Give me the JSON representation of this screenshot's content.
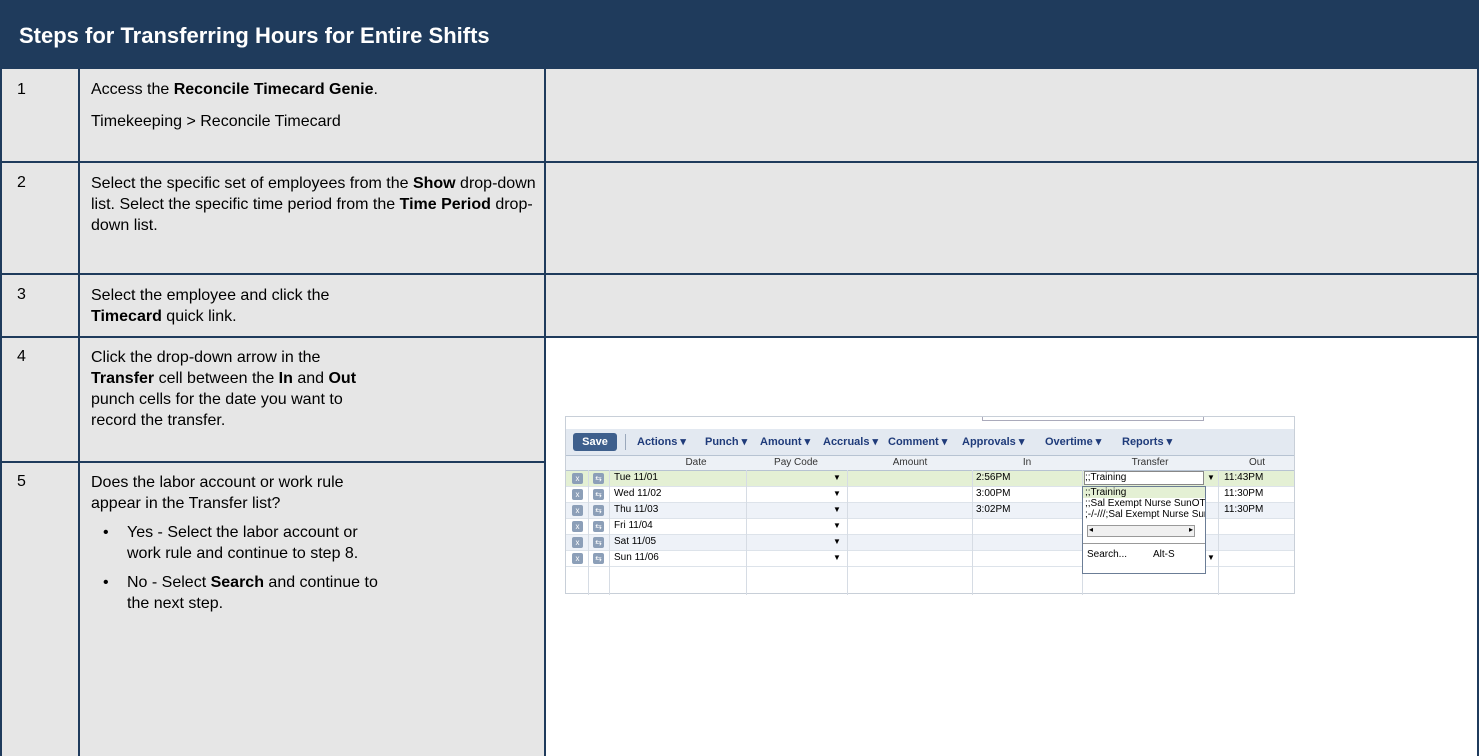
{
  "title": "Steps for Transferring Hours for Entire Shifts",
  "steps": [
    {
      "num": "1",
      "pre": "Access the ",
      "bold": "Reconcile Timecard Genie",
      "post": ".",
      "path": "Timekeeping > Reconcile Timecard"
    },
    {
      "num": "2",
      "text_a": "Select the specific set of employees from the ",
      "b1": "Show",
      "text_b": " drop-down list. Select the specific time period from the ",
      "b2": "Time Period",
      "text_c": " drop-down list."
    },
    {
      "num": "3",
      "text_a": "Select the employee and click the ",
      "b1": "Timecard",
      "text_b": " quick link."
    },
    {
      "num": "4",
      "text_a": "Click the drop-down arrow in the ",
      "b1": "Transfer",
      "text_b": " cell between the ",
      "b2": "In",
      "text_c": " and ",
      "b3": "Out",
      "text_d": " punch cells for the date you want to record the transfer."
    },
    {
      "num": "5",
      "text": "Does the labor account or work rule appear in the Transfer list?",
      "bullet1": "Yes - Select the labor account or work rule and continue to step 8.",
      "bullet2_a": "No - Select ",
      "bullet2_b": "Search",
      "bullet2_c": " and continue to the next step."
    }
  ],
  "screenshot": {
    "save": "Save",
    "menus": [
      "Actions ▾",
      "Punch ▾",
      "Amount ▾",
      "Accruals ▾",
      "Comment ▾",
      "Approvals ▾",
      "Overtime ▾",
      "Reports ▾"
    ],
    "columns": [
      "Date",
      "Pay Code",
      "Amount",
      "In",
      "Transfer",
      "Out"
    ],
    "rows": [
      {
        "date": "Tue 11/01",
        "in": "2:56PM",
        "transfer": ";;Training",
        "out": "11:43PM"
      },
      {
        "date": "Wed 11/02",
        "in": "3:00PM",
        "transfer": "",
        "out": "11:30PM"
      },
      {
        "date": "Thu 11/03",
        "in": "3:02PM",
        "transfer": "",
        "out": "11:30PM"
      },
      {
        "date": "Fri 11/04",
        "in": "",
        "transfer": "",
        "out": ""
      },
      {
        "date": "Sat 11/05",
        "in": "",
        "transfer": "",
        "out": ""
      },
      {
        "date": "Sun 11/06",
        "in": "",
        "transfer": "",
        "out": ""
      }
    ],
    "dropdown": {
      "items": [
        ";;Training",
        ";;Sal Exempt Nurse SunOT I",
        ";-/-///;Sal Exempt Nurse Sur"
      ],
      "search": "Search...",
      "shortcut": "Alt-S"
    }
  }
}
